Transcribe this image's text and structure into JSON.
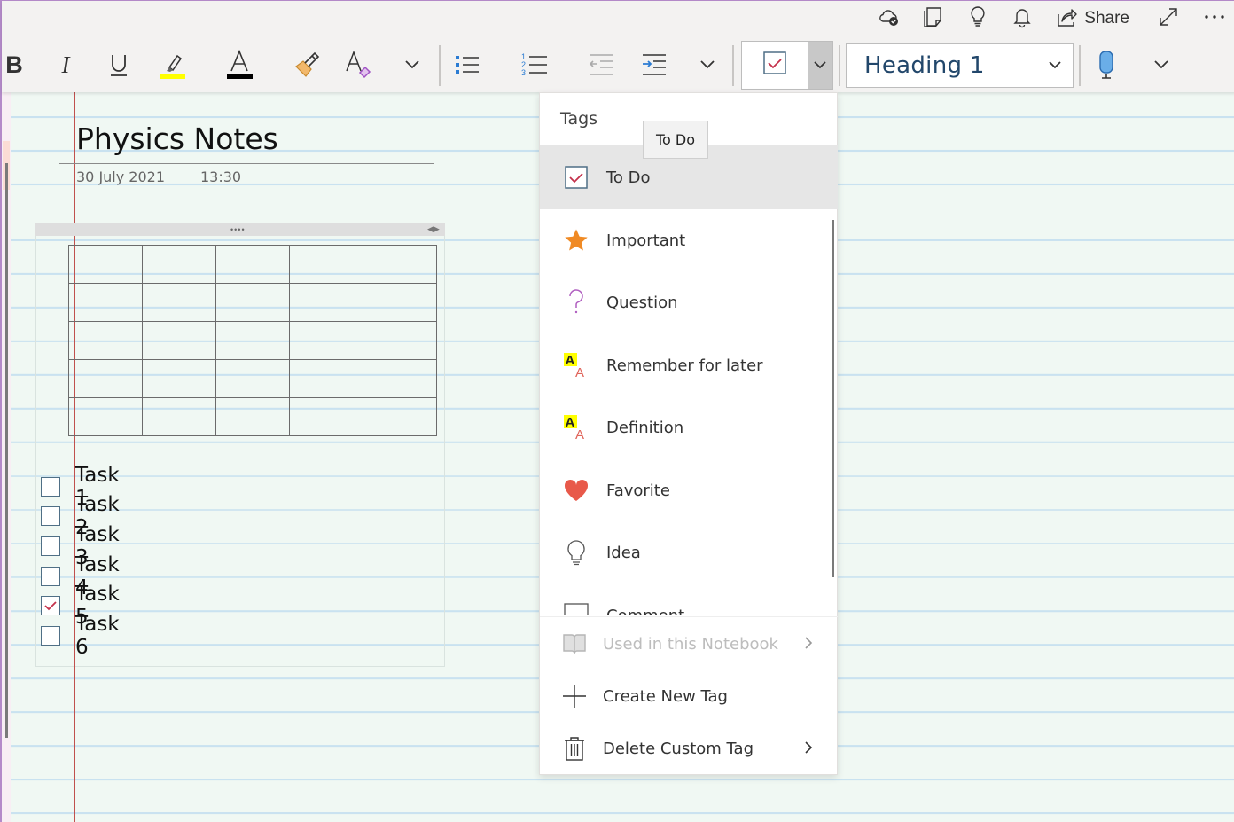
{
  "toolbar": {
    "top": {
      "sync_status": "cloud-sync-icon",
      "sticky_notes": "sticky-notes-icon",
      "tips": "lightbulb-icon",
      "notifications": "bell-icon",
      "share_label": "Share",
      "fullscreen": "expand-icon",
      "more": "more-options-icon"
    },
    "format": {
      "bold_label": "B",
      "italic_label": "I",
      "underline_label": "U",
      "highlight_color": "#ffff00",
      "font_color": "#000000",
      "font_color_letter": "A",
      "clear_format_letter": "A",
      "tag_selected": "To Do",
      "style_value": "Heading 1"
    }
  },
  "page": {
    "title": "Physics Notes",
    "date": "30 July 2021",
    "time": "13:30",
    "table": {
      "rows": 5,
      "cols": 5
    },
    "tasks": [
      {
        "label": "Task 1",
        "checked": false
      },
      {
        "label": "Task 2",
        "checked": false
      },
      {
        "label": "Task 3",
        "checked": false
      },
      {
        "label": "Task 4",
        "checked": false
      },
      {
        "label": "Task 5",
        "checked": true
      },
      {
        "label": "Task 6",
        "checked": false
      }
    ]
  },
  "tags_menu": {
    "header": "Tags",
    "tooltip": "To Do",
    "items": [
      {
        "label": "To Do",
        "icon": "checkbox-icon",
        "selected": true
      },
      {
        "label": "Important",
        "icon": "star-icon",
        "selected": false
      },
      {
        "label": "Question",
        "icon": "question-mark-icon",
        "selected": false
      },
      {
        "label": "Remember for later",
        "icon": "highlight-text-icon",
        "selected": false
      },
      {
        "label": "Definition",
        "icon": "highlight-text-icon",
        "selected": false
      },
      {
        "label": "Favorite",
        "icon": "heart-icon",
        "selected": false
      },
      {
        "label": "Idea",
        "icon": "lightbulb-icon",
        "selected": false
      },
      {
        "label": "Comment",
        "icon": "comment-icon",
        "selected": false
      }
    ],
    "footer": [
      {
        "label": "Used in this Notebook",
        "icon": "book-icon",
        "disabled": true,
        "submenu": true
      },
      {
        "label": "Create New Tag",
        "icon": "plus-icon",
        "disabled": false,
        "submenu": false
      },
      {
        "label": "Delete Custom Tag",
        "icon": "trash-icon",
        "disabled": false,
        "submenu": true
      }
    ]
  },
  "colors": {
    "accent_check": "#c4314b",
    "margin_line": "#c0504d",
    "rule_line": "#c9e2f0",
    "page_bg": "#f0f8f3",
    "star": "#f08a24",
    "heart": "#e8594a",
    "question": "#b05fc0",
    "highlight": "#ffff00"
  }
}
